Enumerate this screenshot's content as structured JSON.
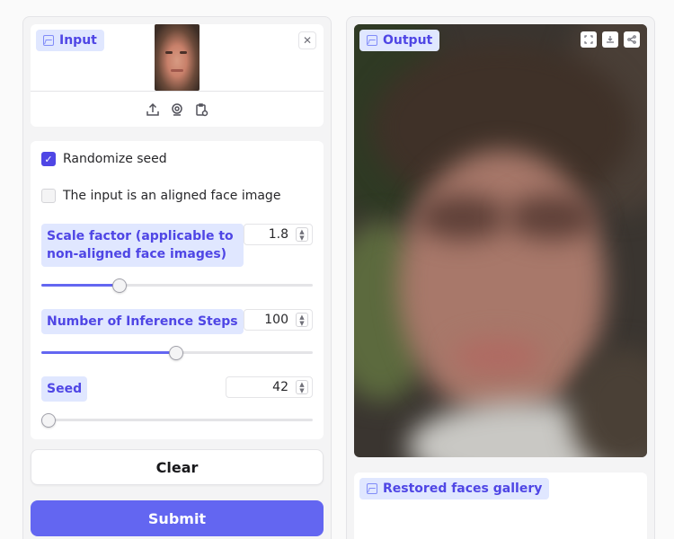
{
  "input": {
    "label": "Input",
    "icons": [
      "upload-icon",
      "webcam-icon",
      "clipboard-icon"
    ],
    "clear_icon": "close-icon"
  },
  "options": {
    "randomize_seed": {
      "label": "Randomize seed",
      "checked": true
    },
    "aligned_face": {
      "label": "The input is an aligned face image",
      "checked": false
    }
  },
  "scale_factor": {
    "label": "Scale factor (applicable to non-aligned face images)",
    "value": "1.8",
    "slider_fraction": 0.275
  },
  "inference_steps": {
    "label": "Number of Inference Steps",
    "value": "100",
    "slider_fraction": 0.495
  },
  "seed": {
    "label": "Seed",
    "value": "42",
    "slider_fraction": 0.0
  },
  "buttons": {
    "clear": "Clear",
    "submit": "Submit"
  },
  "output": {
    "label": "Output",
    "tools": [
      "fullscreen-icon",
      "download-icon",
      "share-icon"
    ]
  },
  "gallery": {
    "label": "Restored faces gallery"
  },
  "colors": {
    "accent": "#6366f1",
    "label_bg": "#e0e7ff",
    "label_text": "#4f46e5"
  }
}
